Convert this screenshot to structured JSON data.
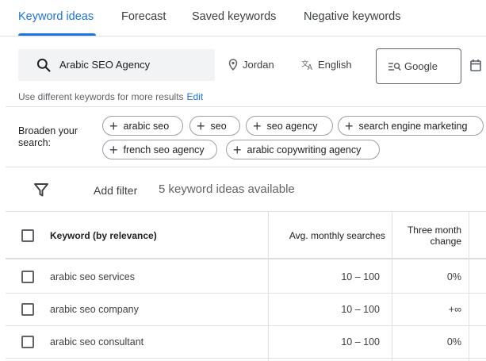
{
  "tabs": [
    {
      "label": "Keyword ideas",
      "active": true
    },
    {
      "label": "Forecast",
      "active": false
    },
    {
      "label": "Saved keywords",
      "active": false
    },
    {
      "label": "Negative keywords",
      "active": false
    }
  ],
  "search": {
    "value": "Arabic SEO Agency",
    "icon": "search-icon"
  },
  "location": {
    "label": "Jordan",
    "icon": "location-pin-icon"
  },
  "language": {
    "label": "English",
    "icon": "translate-icon"
  },
  "network": {
    "label": "Google",
    "icon": "search-network-icon"
  },
  "date": {
    "icon": "calendar-icon"
  },
  "hint": {
    "text": "Use different keywords for more results",
    "edit_label": "Edit"
  },
  "broaden": {
    "label": "Broaden your search:",
    "chips": [
      "arabic seo",
      "seo",
      "seo agency",
      "search engine marketing",
      "french seo agency",
      "arabic copywriting agency"
    ]
  },
  "toolbar": {
    "add_filter_label": "Add filter",
    "ideas_count": "5 keyword ideas available"
  },
  "table": {
    "headers": {
      "keyword": "Keyword (by relevance)",
      "searches": "Avg. monthly searches",
      "change": "Three month change"
    },
    "rows": [
      {
        "keyword": "arabic seo services",
        "searches": "10 – 100",
        "change": "0%"
      },
      {
        "keyword": "arabic seo company",
        "searches": "10 – 100",
        "change": "+∞"
      },
      {
        "keyword": "arabic seo consultant",
        "searches": "10 – 100",
        "change": "0%"
      }
    ]
  },
  "colors": {
    "accent": "#1a73e8",
    "text": "#202124",
    "muted": "#5f6368",
    "border": "#e0e0e0"
  }
}
